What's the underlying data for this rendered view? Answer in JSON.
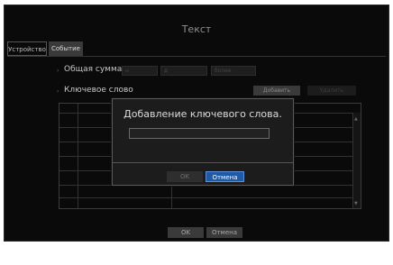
{
  "window": {
    "title": "Текст"
  },
  "tabs": [
    {
      "label": "Устройство"
    },
    {
      "label": "Событие"
    }
  ],
  "sum": {
    "label": "Общая сумма",
    "field1": "н",
    "field2": "д",
    "field3": "более"
  },
  "keywords": {
    "label": "Ключевое слово",
    "add_label": "Добавить",
    "delete_label": "Удалить"
  },
  "dialog": {
    "title": "Добавление ключевого слова.",
    "input_value": "",
    "ok_label": "OK",
    "cancel_label": "Отмена"
  },
  "footer": {
    "ok_label": "OK",
    "cancel_label": "Отмена"
  },
  "colors": {
    "accent": "#1f5aa8",
    "background": "#0a0a0a"
  }
}
